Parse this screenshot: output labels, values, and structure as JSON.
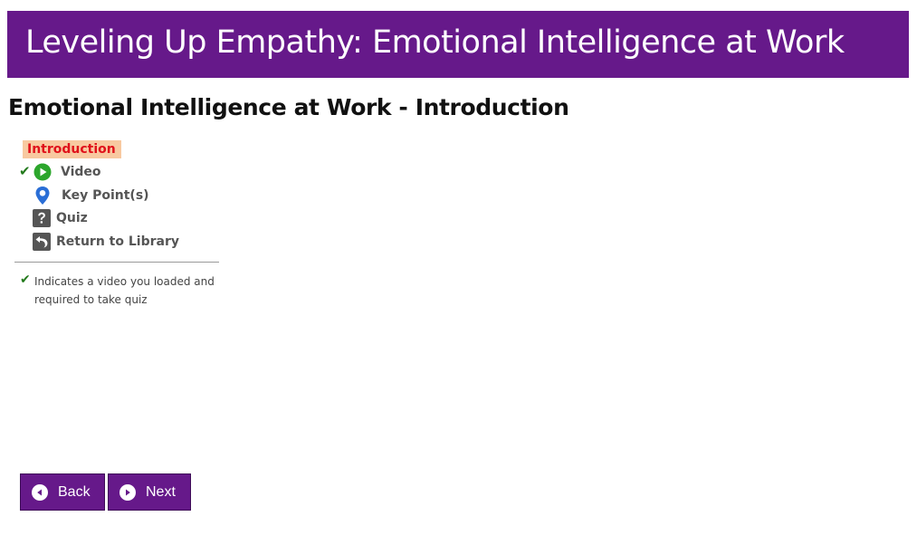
{
  "banner": {
    "title": "Leveling Up Empathy: Emotional Intelligence at Work"
  },
  "page": {
    "title": "Emotional Intelligence at Work - Introduction"
  },
  "nav": {
    "section_label": "Introduction",
    "items": [
      {
        "label": "Video",
        "icon": "play-circle-icon",
        "checked": true,
        "icon_color": "#2ca62c"
      },
      {
        "label": "Key Point(s)",
        "icon": "map-pin-icon",
        "icon_color": "#2a6ed6"
      },
      {
        "label": "Quiz",
        "icon": "question-square-icon",
        "icon_color": "#555555"
      },
      {
        "label": "Return to Library",
        "icon": "return-arrow-icon",
        "icon_color": "#555555"
      }
    ],
    "legend": "Indicates a video you loaded and required to take quiz"
  },
  "buttons": {
    "back_label": "Back",
    "next_label": "Next"
  },
  "colors": {
    "brand": "#66198a",
    "check": "#237a1c",
    "section_highlight": "#f8c9a0",
    "section_text": "#e0121b"
  }
}
